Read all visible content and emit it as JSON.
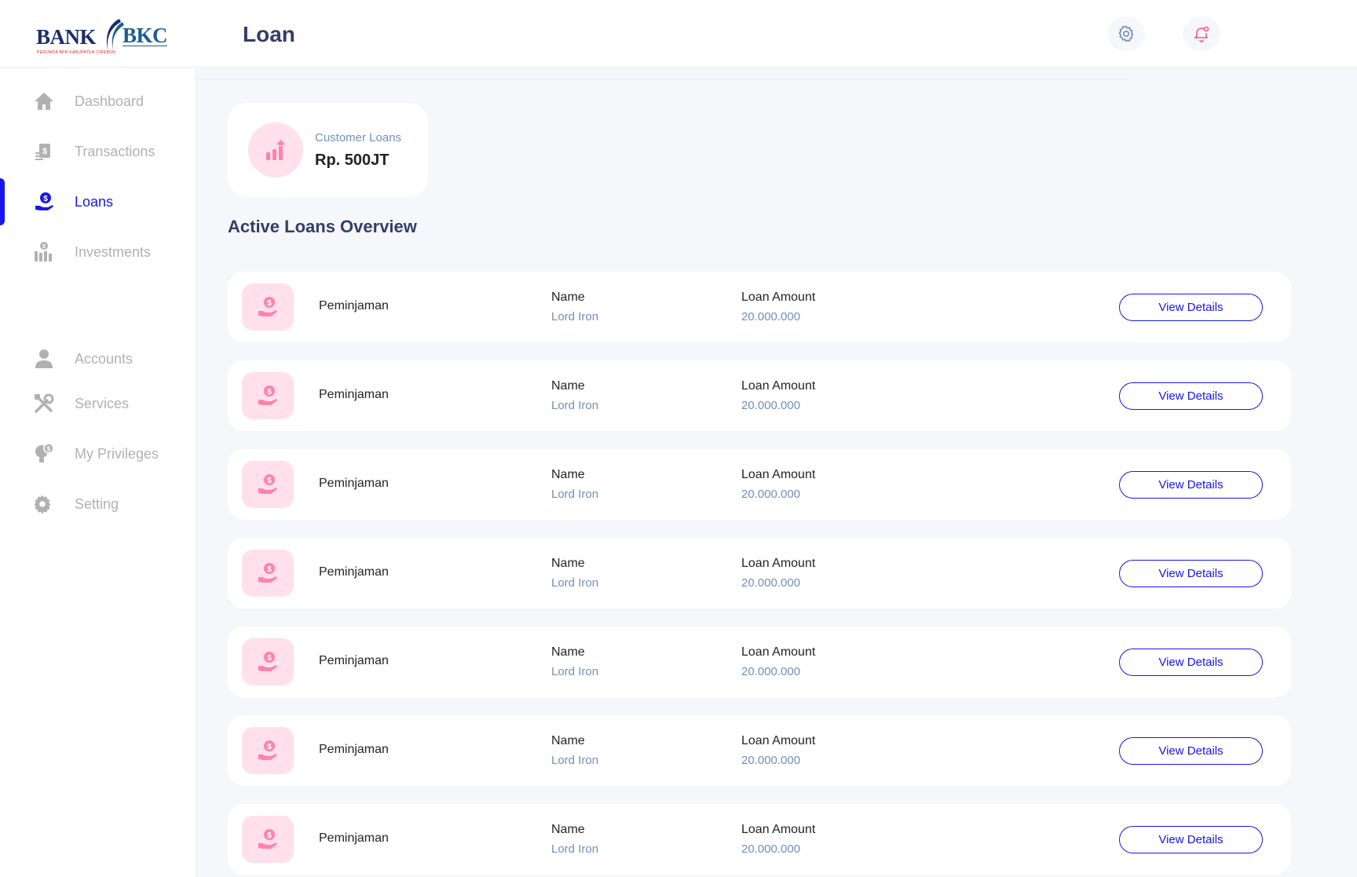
{
  "brand": {
    "name_left": "BANK",
    "name_right": "BKC",
    "tagline": "PERUMDA BPR KABUPATEN CIREBON"
  },
  "header": {
    "title": "Loan",
    "settings_icon": "gear-icon",
    "notification_icon": "bell-icon"
  },
  "sidebar": {
    "items": [
      {
        "label": "Dashboard",
        "icon": "home-icon"
      },
      {
        "label": "Transactions",
        "icon": "transfer-icon"
      },
      {
        "label": "Loans",
        "icon": "loan-icon",
        "active": true
      },
      {
        "label": "Investments",
        "icon": "investment-icon"
      },
      {
        "label": "Accounts",
        "icon": "user-icon"
      },
      {
        "label": "Services",
        "icon": "tools-icon"
      },
      {
        "label": "My Privileges",
        "icon": "privilege-icon"
      },
      {
        "label": "Setting",
        "icon": "gear-icon"
      }
    ]
  },
  "summary": {
    "label": "Customer Loans",
    "value": "Rp. 500JT"
  },
  "section": {
    "title": "Active Loans Overview"
  },
  "loans": [
    {
      "type": "Peminjaman",
      "name_header": "Name",
      "name": "Lord Iron",
      "amount_header": "Loan Amount",
      "amount": "20.000.000",
      "action": "View Details"
    },
    {
      "type": "Peminjaman",
      "name_header": "Name",
      "name": "Lord Iron",
      "amount_header": "Loan Amount",
      "amount": "20.000.000",
      "action": "View Details"
    },
    {
      "type": "Peminjaman",
      "name_header": "Name",
      "name": "Lord Iron",
      "amount_header": "Loan Amount",
      "amount": "20.000.000",
      "action": "View Details"
    },
    {
      "type": "Peminjaman",
      "name_header": "Name",
      "name": "Lord Iron",
      "amount_header": "Loan Amount",
      "amount": "20.000.000",
      "action": "View Details"
    },
    {
      "type": "Peminjaman",
      "name_header": "Name",
      "name": "Lord Iron",
      "amount_header": "Loan Amount",
      "amount": "20.000.000",
      "action": "View Details"
    },
    {
      "type": "Peminjaman",
      "name_header": "Name",
      "name": "Lord Iron",
      "amount_header": "Loan Amount",
      "amount": "20.000.000",
      "action": "View Details"
    },
    {
      "type": "Peminjaman",
      "name_header": "Name",
      "name": "Lord Iron",
      "amount_header": "Loan Amount",
      "amount": "20.000.000",
      "action": "View Details"
    }
  ],
  "colors": {
    "accent": "#1814f3",
    "pink": "#ff82ac",
    "pink_bg": "#ffe0eb",
    "muted": "#718ebf"
  }
}
